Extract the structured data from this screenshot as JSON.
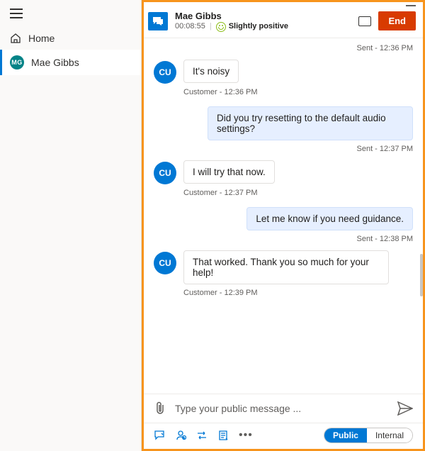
{
  "sidebar": {
    "home": "Home",
    "active": {
      "initials": "MG",
      "name": "Mae Gibbs"
    }
  },
  "header": {
    "name": "Mae Gibbs",
    "timer": "00:08:55",
    "sentiment": "Slightly positive",
    "end": "End"
  },
  "msgs": {
    "sent0": "Sent - 12:36 PM",
    "c1": "It's noisy",
    "c1meta": "Customer - 12:36 PM",
    "a1": "Did you try resetting to the default audio settings?",
    "a1meta": "Sent - 12:37 PM",
    "c2": "I will try that now.",
    "c2meta": "Customer - 12:37 PM",
    "a2": "Let me know if you need guidance.",
    "a2meta": "Sent - 12:38 PM",
    "c3": "That worked. Thank you so much for your help!",
    "c3meta": "Customer - 12:39 PM",
    "cu": "CU"
  },
  "compose": {
    "placeholder": "Type your public message ..."
  },
  "bottom": {
    "public": "Public",
    "internal": "Internal"
  }
}
